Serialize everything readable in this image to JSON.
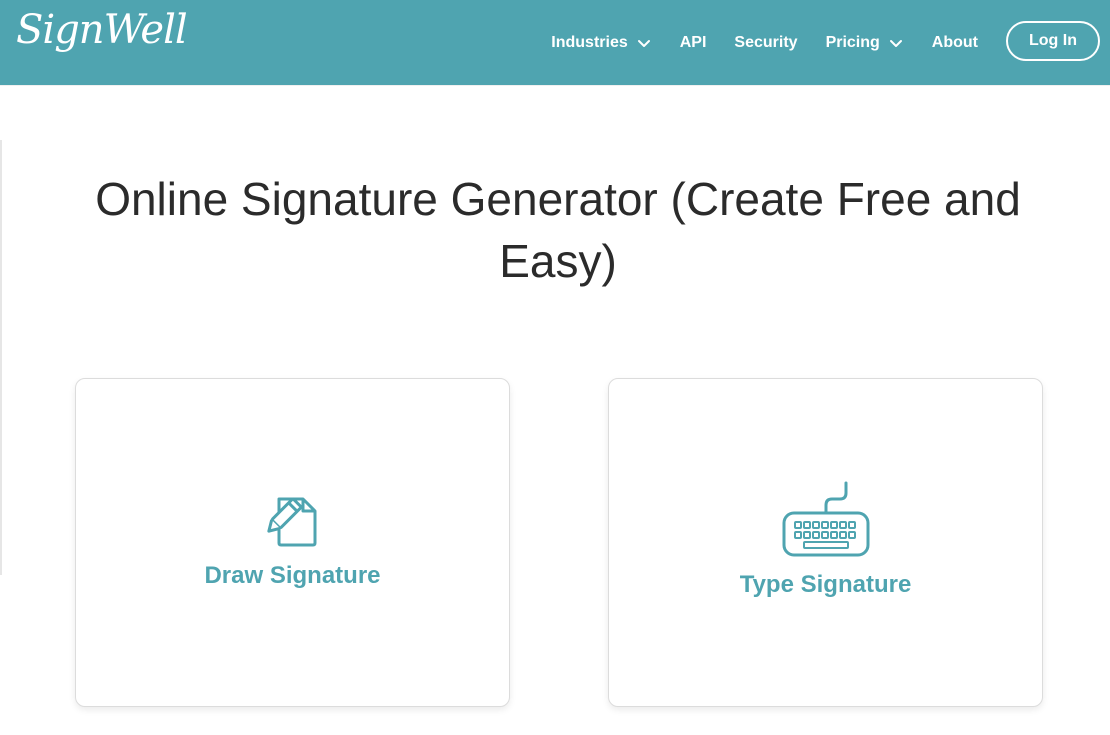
{
  "header": {
    "logo_text": "SignWell",
    "nav": [
      {
        "label": "Industries",
        "has_dropdown": true
      },
      {
        "label": "API",
        "has_dropdown": false
      },
      {
        "label": "Security",
        "has_dropdown": false
      },
      {
        "label": "Pricing",
        "has_dropdown": true
      },
      {
        "label": "About",
        "has_dropdown": false
      }
    ],
    "login_label": "Log In"
  },
  "main": {
    "title": "Online Signature Generator (Create Free and Easy)",
    "cards": [
      {
        "label": "Draw Signature",
        "icon": "pencil-document-icon"
      },
      {
        "label": "Type Signature",
        "icon": "keyboard-icon"
      }
    ]
  },
  "colors": {
    "brand": "#4fa4b0",
    "title_text": "#2b2b2b",
    "card_border": "#dcdcdc"
  }
}
